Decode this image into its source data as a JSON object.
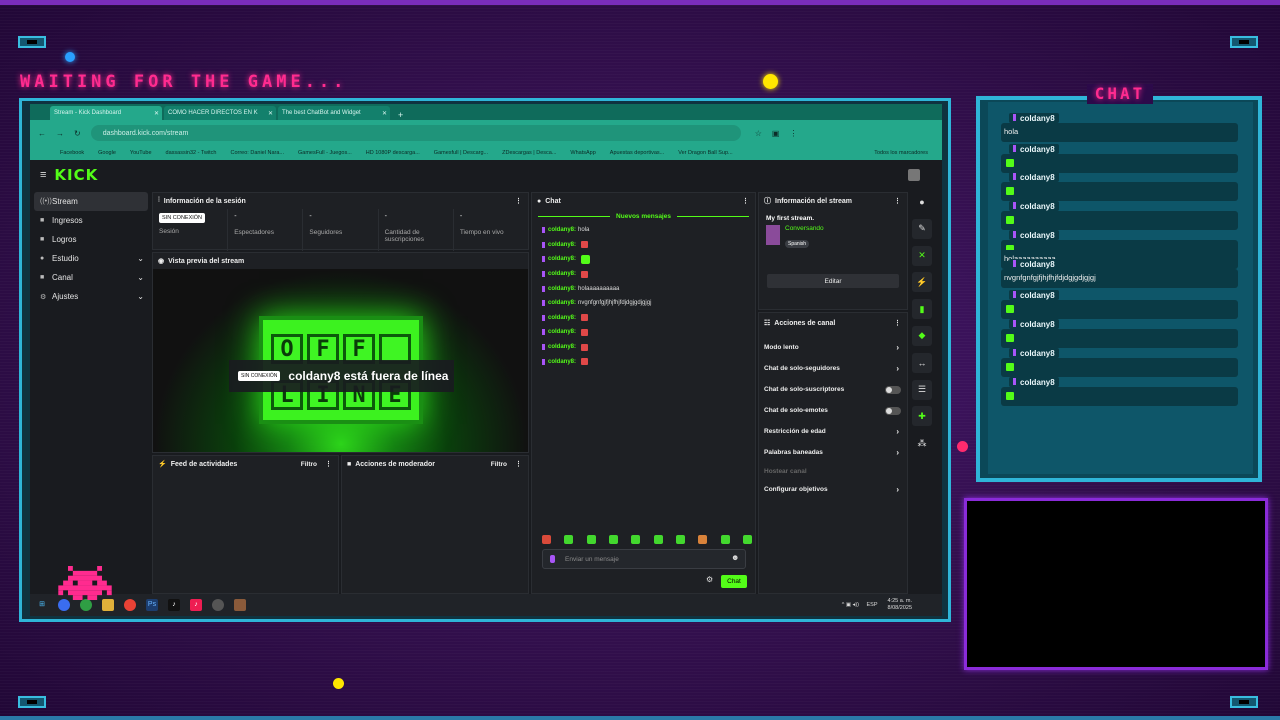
{
  "overlay": {
    "waiting_text": "WAITING FOR THE GAME...",
    "chat_title": "CHAT",
    "messages": [
      {
        "user": "coldany8",
        "text": "hola",
        "emote": false
      },
      {
        "user": "coldany8",
        "text": "",
        "emote": true
      },
      {
        "user": "coldany8",
        "text": "",
        "emote": true
      },
      {
        "user": "coldany8",
        "text": "",
        "emote": true
      },
      {
        "user": "coldany8",
        "text": "",
        "emote": true
      },
      {
        "user": "",
        "text": "holaaaaaaaaaa",
        "emote": false
      },
      {
        "user": "coldany8",
        "text": "nvgnfgnfgjfjhjfhjfdjdgjgdjgjgj",
        "emote": false
      },
      {
        "user": "coldany8",
        "text": "",
        "emote": true
      },
      {
        "user": "coldany8",
        "text": "",
        "emote": true
      },
      {
        "user": "coldany8",
        "text": "",
        "emote": true
      },
      {
        "user": "coldany8",
        "text": "",
        "emote": true
      }
    ]
  },
  "browser": {
    "tabs": [
      "Stream - Kick Dashboard",
      "COMO HACER DIRECTOS EN K",
      "The best ChatBot and Widget"
    ],
    "url": "dashboard.kick.com/stream",
    "bookmarks": [
      "Facebook",
      "Google",
      "YouTube",
      "dassassin32 - Twitch",
      "Correo: Daniel Nara...",
      "GamesFull - Juegos...",
      "HD 1080P descarga...",
      "Gamesfull | Descarg...",
      "ZDescargas | Desca...",
      "WhatsApp",
      "Apuestas deportivas...",
      "Ver Dragon Ball Sup..."
    ],
    "all_bookmarks": "Todos los marcadores"
  },
  "kick": {
    "logo": "KICK",
    "sidebar": [
      {
        "label": "Stream",
        "icon": "((•))",
        "chevron": false
      },
      {
        "label": "Ingresos",
        "icon": "■",
        "chevron": false
      },
      {
        "label": "Logros",
        "icon": "■",
        "chevron": false
      },
      {
        "label": "Estudio",
        "icon": "●",
        "chevron": true
      },
      {
        "label": "Canal",
        "icon": "■",
        "chevron": true
      },
      {
        "label": "Ajustes",
        "icon": "⚙",
        "chevron": true
      }
    ],
    "session": {
      "title": "Información de la sesión",
      "badge": "SIN CONEXIÓN",
      "stats": [
        {
          "value": "",
          "label": "Sesión"
        },
        {
          "value": "-",
          "label": "Espectadores"
        },
        {
          "value": "-",
          "label": "Seguidores"
        },
        {
          "value": "-",
          "label": "Cantidad de suscripciones"
        },
        {
          "value": "-",
          "label": "Tiempo en vivo"
        }
      ]
    },
    "preview": {
      "title": "Vista previa del stream",
      "badge": "SIN CONEXIÓN",
      "offline_text": "coldany8 está fuera de línea",
      "sign_letters": [
        "O",
        "F",
        "F",
        "",
        "L",
        "I",
        "N",
        "E"
      ]
    },
    "feed": {
      "title": "Feed de actividades",
      "filter": "Filtro"
    },
    "moderator": {
      "title": "Acciones de moderador",
      "filter": "Filtro"
    },
    "chat": {
      "title": "Chat",
      "new_messages": "Nuevos mensajes",
      "lines": [
        {
          "user": "coldany8:",
          "text": "hola",
          "emote": "",
          "green": false
        },
        {
          "user": "coldany8:",
          "text": "",
          "emote": "red",
          "green": false
        },
        {
          "user": "coldany8:",
          "text": "",
          "emote": "green",
          "green": true
        },
        {
          "user": "coldany8:",
          "text": "",
          "emote": "red",
          "green": false
        },
        {
          "user": "coldany8:",
          "text": "holaaaaaaaaaa",
          "emote": "",
          "green": false
        },
        {
          "user": "coldany8:",
          "text": "nvgnfgnfgjfjhjfhjfdjdgjgdjgjgj",
          "emote": "",
          "green": false
        },
        {
          "user": "coldany8:",
          "text": "",
          "emote": "red",
          "green": false
        },
        {
          "user": "coldany8:",
          "text": "",
          "emote": "red",
          "green": false
        },
        {
          "user": "coldany8:",
          "text": "",
          "emote": "red",
          "green": false
        },
        {
          "user": "coldany8:",
          "text": "",
          "emote": "red",
          "green": false
        }
      ],
      "placeholder": "Enviar un mensaje",
      "send_label": "Chat"
    },
    "stream_info": {
      "title": "Información del stream",
      "stream_title": "My first stream.",
      "category": "Conversando",
      "language": "Spanish",
      "edit_label": "Editar"
    },
    "channel_actions": {
      "title": "Acciones de canal",
      "items": [
        {
          "label": "Modo lento",
          "kind": "chevron",
          "dim": false
        },
        {
          "label": "Chat de solo-seguidores",
          "kind": "chevron",
          "dim": false
        },
        {
          "label": "Chat de solo-suscriptores",
          "kind": "toggle",
          "dim": false
        },
        {
          "label": "Chat de solo-emotes",
          "kind": "toggle",
          "dim": false
        },
        {
          "label": "Restricción de edad",
          "kind": "chevron",
          "dim": false
        },
        {
          "label": "Palabras baneadas",
          "kind": "chevron",
          "dim": false
        },
        {
          "label": "Hostear canal",
          "kind": "none",
          "dim": true
        },
        {
          "label": "Configurar objetivos",
          "kind": "chevron",
          "dim": false
        }
      ]
    }
  },
  "taskbar": {
    "lang": "ESP",
    "time": "4:25 a. m.",
    "date": "8/08/2025"
  }
}
